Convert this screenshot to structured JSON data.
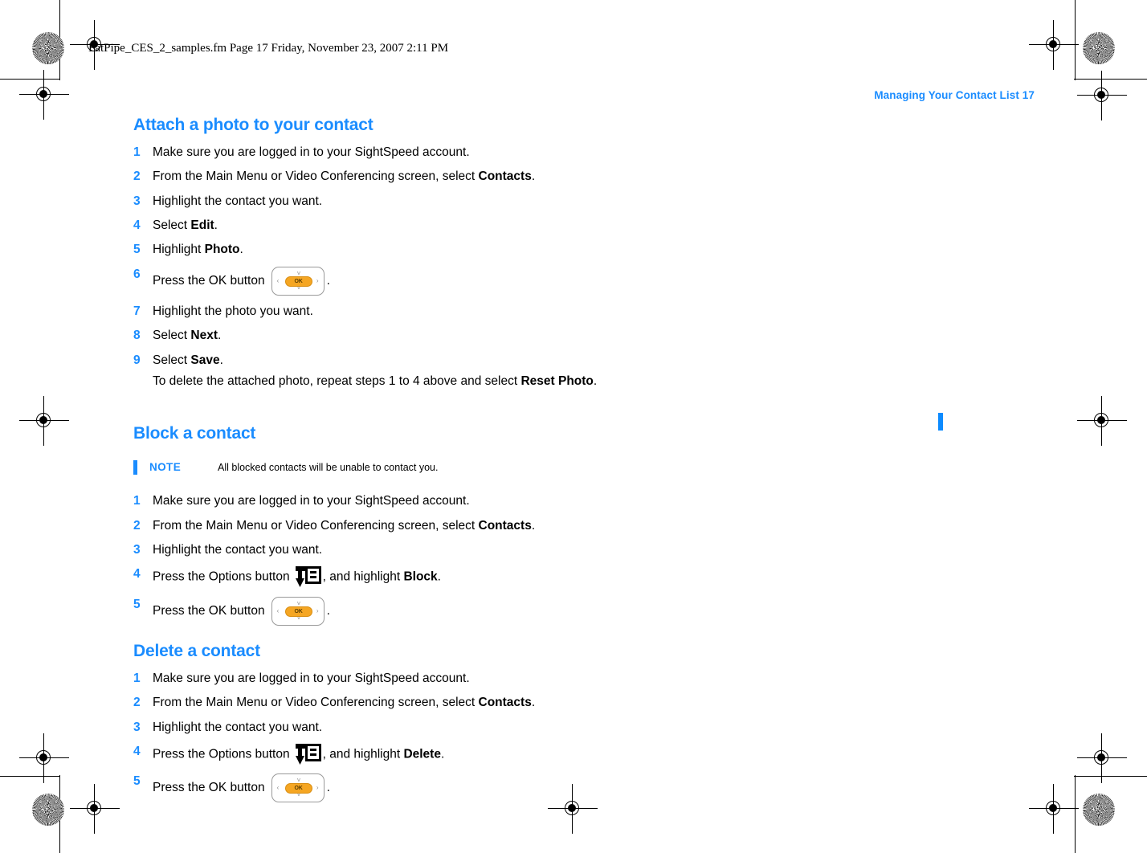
{
  "print_banner": {
    "text": "FatPipe_CES_2_samples.fm  Page 17  Friday, November 23, 2007  2:11 PM"
  },
  "running_head": {
    "text": "Managing Your Contact List  17"
  },
  "colors": {
    "accent_blue": "#1a8cff",
    "change_bar_blue": "#0d8bff",
    "ok_button_orange": "#f5a623",
    "body_text": "#000000"
  },
  "sections": [
    {
      "id": "attach-photo",
      "heading": "Attach a photo to your contact",
      "steps": [
        {
          "num": "1",
          "parts": [
            {
              "t": "Make sure you are logged in to your SightSpeed account.",
              "b": false
            }
          ]
        },
        {
          "num": "2",
          "parts": [
            {
              "t": "From the Main Menu or Video Conferencing screen, select ",
              "b": false
            },
            {
              "t": "Contacts",
              "b": true
            },
            {
              "t": ".",
              "b": false
            }
          ]
        },
        {
          "num": "3",
          "parts": [
            {
              "t": "Highlight the contact you want.",
              "b": false
            }
          ]
        },
        {
          "num": "4",
          "parts": [
            {
              "t": "Select ",
              "b": false
            },
            {
              "t": "Edit",
              "b": true
            },
            {
              "t": ".",
              "b": false
            }
          ]
        },
        {
          "num": "5",
          "parts": [
            {
              "t": "Highlight ",
              "b": false
            },
            {
              "t": "Photo",
              "b": true
            },
            {
              "t": ".",
              "b": false
            }
          ]
        },
        {
          "num": "6",
          "icon": "ok-button",
          "parts": [
            {
              "t": "Press the OK button",
              "b": false
            }
          ],
          "after_icon": "."
        },
        {
          "num": "7",
          "parts": [
            {
              "t": "Highlight the photo you want.",
              "b": false
            }
          ]
        },
        {
          "num": "8",
          "parts": [
            {
              "t": "Select ",
              "b": false
            },
            {
              "t": "Next",
              "b": true
            },
            {
              "t": ".",
              "b": false
            }
          ]
        },
        {
          "num": "9",
          "parts": [
            {
              "t": "Select ",
              "b": false
            },
            {
              "t": "Save",
              "b": true
            },
            {
              "t": ".",
              "b": false
            }
          ],
          "sub_parts": [
            {
              "t": "To delete the attached photo, repeat steps 1 to 4 above and select ",
              "b": false
            },
            {
              "t": "Reset Photo",
              "b": true
            },
            {
              "t": ".",
              "b": false
            }
          ]
        }
      ]
    },
    {
      "id": "block-contact",
      "heading": "Block a contact",
      "note": {
        "label": "NOTE",
        "text": "All blocked contacts will be unable to contact you."
      },
      "steps": [
        {
          "num": "1",
          "parts": [
            {
              "t": "Make sure you are logged in to your SightSpeed account.",
              "b": false
            }
          ]
        },
        {
          "num": "2",
          "parts": [
            {
              "t": "From the Main Menu or Video Conferencing screen, select ",
              "b": false
            },
            {
              "t": "Contacts",
              "b": true
            },
            {
              "t": ".",
              "b": false
            }
          ]
        },
        {
          "num": "3",
          "parts": [
            {
              "t": "Highlight the contact you want.",
              "b": false
            }
          ]
        },
        {
          "num": "4",
          "icon": "options-button",
          "parts": [
            {
              "t": "Press the Options button",
              "b": false
            }
          ],
          "after_icon": ", and highlight ",
          "after_parts": [
            {
              "t": "Block",
              "b": true
            },
            {
              "t": ".",
              "b": false
            }
          ]
        },
        {
          "num": "5",
          "icon": "ok-button",
          "parts": [
            {
              "t": "Press the OK button",
              "b": false
            }
          ],
          "after_icon": "."
        }
      ]
    },
    {
      "id": "delete-contact",
      "heading": "Delete a contact",
      "steps": [
        {
          "num": "1",
          "parts": [
            {
              "t": "Make sure you are logged in to your SightSpeed account.",
              "b": false
            }
          ]
        },
        {
          "num": "2",
          "parts": [
            {
              "t": "From the Main Menu or Video Conferencing screen, select ",
              "b": false
            },
            {
              "t": "Contacts",
              "b": true
            },
            {
              "t": ".",
              "b": false
            }
          ]
        },
        {
          "num": "3",
          "parts": [
            {
              "t": "Highlight the contact you want.",
              "b": false
            }
          ]
        },
        {
          "num": "4",
          "icon": "options-button",
          "parts": [
            {
              "t": "Press the Options button",
              "b": false
            }
          ],
          "after_icon": ", and highlight ",
          "after_parts": [
            {
              "t": "Delete",
              "b": true
            },
            {
              "t": ".",
              "b": false
            }
          ]
        },
        {
          "num": "5",
          "icon": "ok-button",
          "parts": [
            {
              "t": "Press the OK button",
              "b": false
            }
          ],
          "after_icon": "."
        }
      ]
    }
  ],
  "icons": {
    "ok_button": {
      "name": "ok-nav-button-icon",
      "label": "OK",
      "arrows": [
        "˄",
        "˅",
        "‹",
        "›"
      ]
    },
    "options_button": {
      "name": "options-menu-button-icon"
    }
  }
}
